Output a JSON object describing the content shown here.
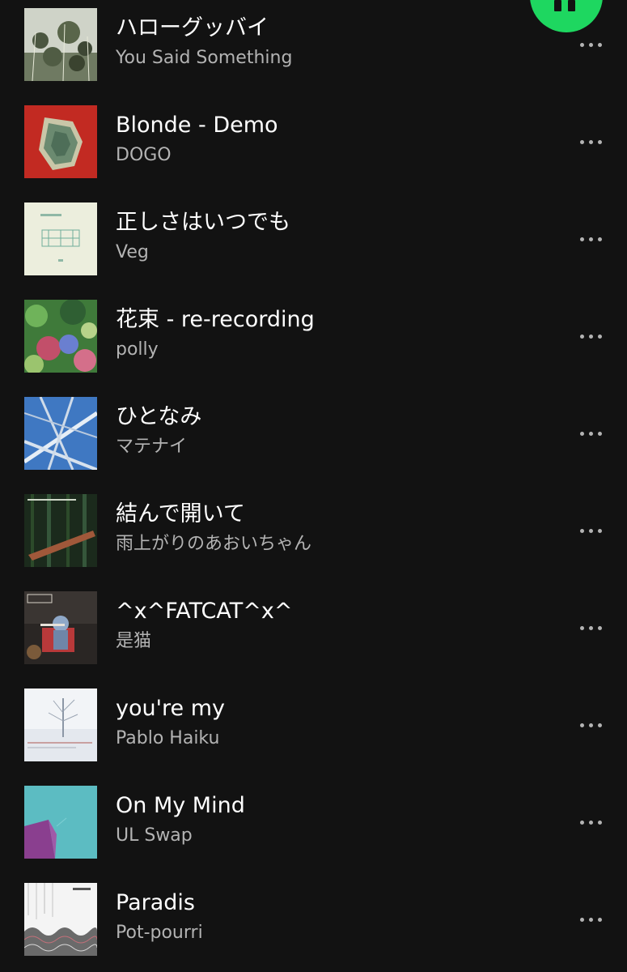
{
  "player": {
    "fab_icon": "pause-icon",
    "accent_color": "#1ed760"
  },
  "more_icon": "more-horizontal-icon",
  "tracks": [
    {
      "title": "ハローグッバイ",
      "artist": "You Said Something"
    },
    {
      "title": "Blonde - Demo",
      "artist": "DOGO"
    },
    {
      "title": "正しさはいつでも",
      "artist": "Veg"
    },
    {
      "title": "花束 - re-recording",
      "artist": "polly"
    },
    {
      "title": "ひとなみ",
      "artist": "マテナイ"
    },
    {
      "title": "結んで開いて",
      "artist": "雨上がりのあおいちゃん"
    },
    {
      "title": "^x^FATCAT^x^",
      "artist": "是猫"
    },
    {
      "title": "you're my",
      "artist": "Pablo Haiku"
    },
    {
      "title": "On My Mind",
      "artist": "UL Swap"
    },
    {
      "title": "Paradis",
      "artist": "Pot-pourri"
    }
  ]
}
